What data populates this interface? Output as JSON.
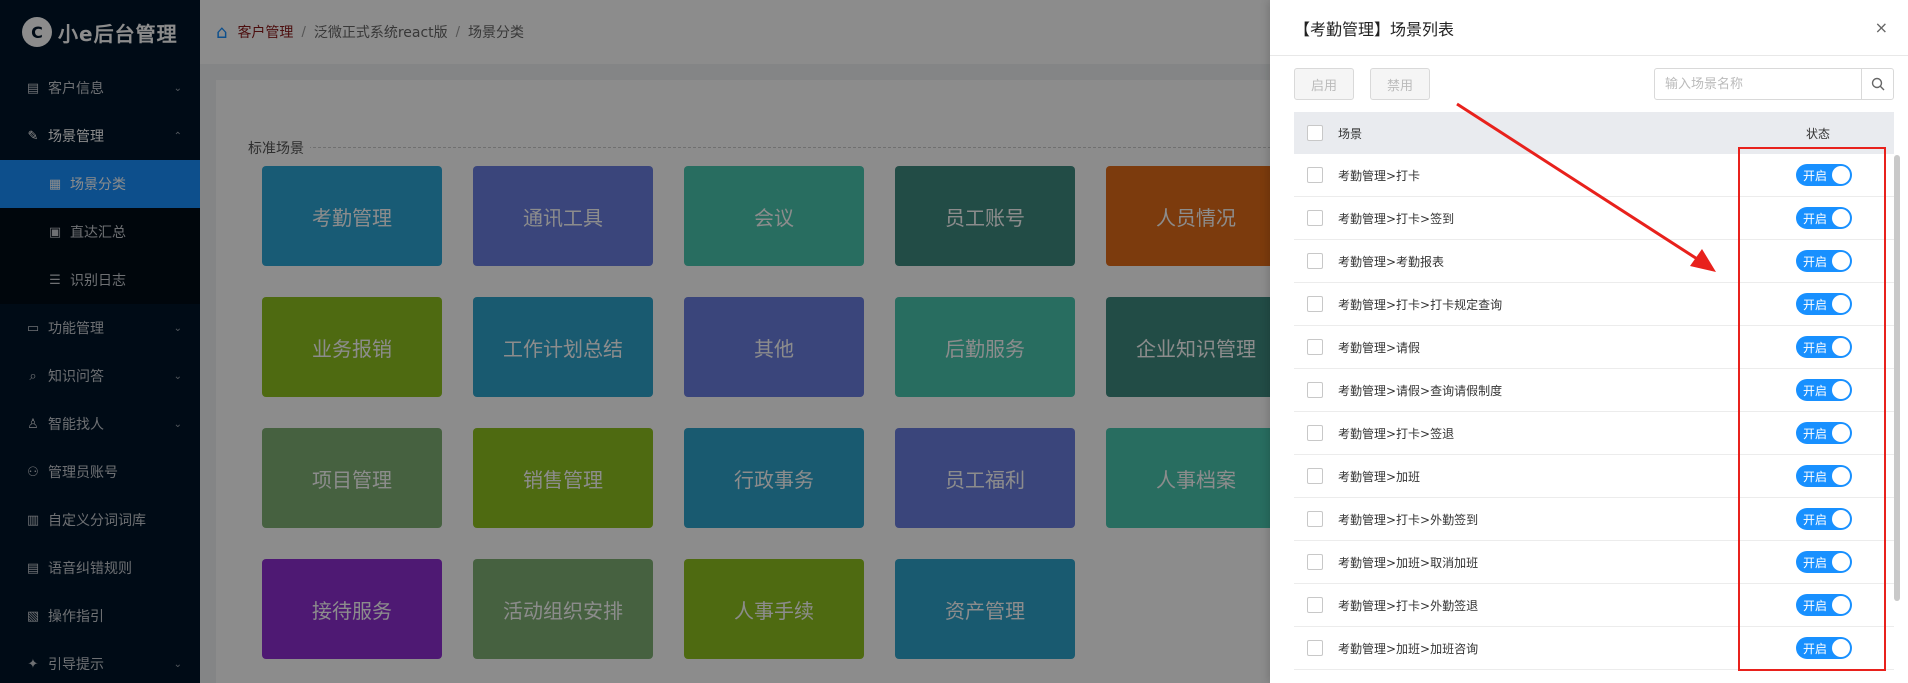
{
  "app": {
    "logo_mark": "C",
    "logo_text": "小e后台管理"
  },
  "sidebar": {
    "items": [
      {
        "label": "客户信息",
        "icon": "document-icon",
        "chevron": "down"
      },
      {
        "label": "场景管理",
        "icon": "edit-icon",
        "chevron": "up",
        "open": true,
        "children": [
          {
            "label": "场景分类",
            "icon": "grid-icon",
            "active": true
          },
          {
            "label": "直达汇总",
            "icon": "image-icon"
          },
          {
            "label": "识别日志",
            "icon": "list-icon"
          }
        ]
      },
      {
        "label": "功能管理",
        "icon": "monitor-icon",
        "chevron": "down"
      },
      {
        "label": "知识问答",
        "icon": "search-icon",
        "chevron": "down"
      },
      {
        "label": "智能找人",
        "icon": "user-icon",
        "chevron": "down"
      },
      {
        "label": "管理员账号",
        "icon": "team-icon"
      },
      {
        "label": "自定义分词词库",
        "icon": "book-icon"
      },
      {
        "label": "语音纠错规则",
        "icon": "doc-icon"
      },
      {
        "label": "操作指引",
        "icon": "file-icon"
      },
      {
        "label": "引导提示",
        "icon": "bulb-icon",
        "chevron": "down"
      }
    ]
  },
  "breadcrumb": [
    "客户管理",
    "泛微正式系统react版",
    "场景分类"
  ],
  "main": {
    "section_title": "标准场景",
    "tiles": [
      {
        "label": "考勤管理",
        "color": "#2da7d6"
      },
      {
        "label": "通讯工具",
        "color": "#6a7ee0"
      },
      {
        "label": "会议",
        "color": "#49c6b0"
      },
      {
        "label": "员工账号",
        "color": "#3f8a80"
      },
      {
        "label": "人员情况",
        "color": "#e26c19"
      },
      {
        "label": "业务报销",
        "color": "#8fc21f"
      },
      {
        "label": "工作计划总结",
        "color": "#2ea4cc"
      },
      {
        "label": "其他",
        "color": "#6a7ee0"
      },
      {
        "label": "后勤服务",
        "color": "#49c6b0"
      },
      {
        "label": "企业知识管理",
        "color": "#3f8a80"
      },
      {
        "label": "项目管理",
        "color": "#80b176"
      },
      {
        "label": "销售管理",
        "color": "#8fc21f"
      },
      {
        "label": "行政事务",
        "color": "#2ea4cc"
      },
      {
        "label": "员工福利",
        "color": "#6a7ee0"
      },
      {
        "label": "人事档案",
        "color": "#49c6b0"
      },
      {
        "label": "接待服务",
        "color": "#8e2fd1"
      },
      {
        "label": "活动组织安排",
        "color": "#80b176"
      },
      {
        "label": "人事手续",
        "color": "#8fc21f"
      },
      {
        "label": "资产管理",
        "color": "#2ea4cc"
      }
    ]
  },
  "drawer": {
    "title": "【考勤管理】场景列表",
    "close": "×",
    "enable_btn": "启用",
    "disable_btn": "禁用",
    "search_placeholder": "输入场景名称",
    "table": {
      "headers": [
        "场景",
        "状态"
      ],
      "rows": [
        {
          "name": "考勤管理>打卡",
          "status": "开启"
        },
        {
          "name": "考勤管理>打卡>签到",
          "status": "开启"
        },
        {
          "name": "考勤管理>考勤报表",
          "status": "开启"
        },
        {
          "name": "考勤管理>打卡>打卡规定查询",
          "status": "开启"
        },
        {
          "name": "考勤管理>请假",
          "status": "开启"
        },
        {
          "name": "考勤管理>请假>查询请假制度",
          "status": "开启"
        },
        {
          "name": "考勤管理>打卡>签退",
          "status": "开启"
        },
        {
          "name": "考勤管理>加班",
          "status": "开启"
        },
        {
          "name": "考勤管理>打卡>外勤签到",
          "status": "开启"
        },
        {
          "name": "考勤管理>加班>取消加班",
          "status": "开启"
        },
        {
          "name": "考勤管理>打卡>外勤签退",
          "status": "开启"
        },
        {
          "name": "考勤管理>加班>加班咨询",
          "status": "开启"
        }
      ]
    }
  },
  "colors": {
    "accent": "#1890ff",
    "sidebar_bg": "#001529",
    "annotation": "#e8211c"
  }
}
